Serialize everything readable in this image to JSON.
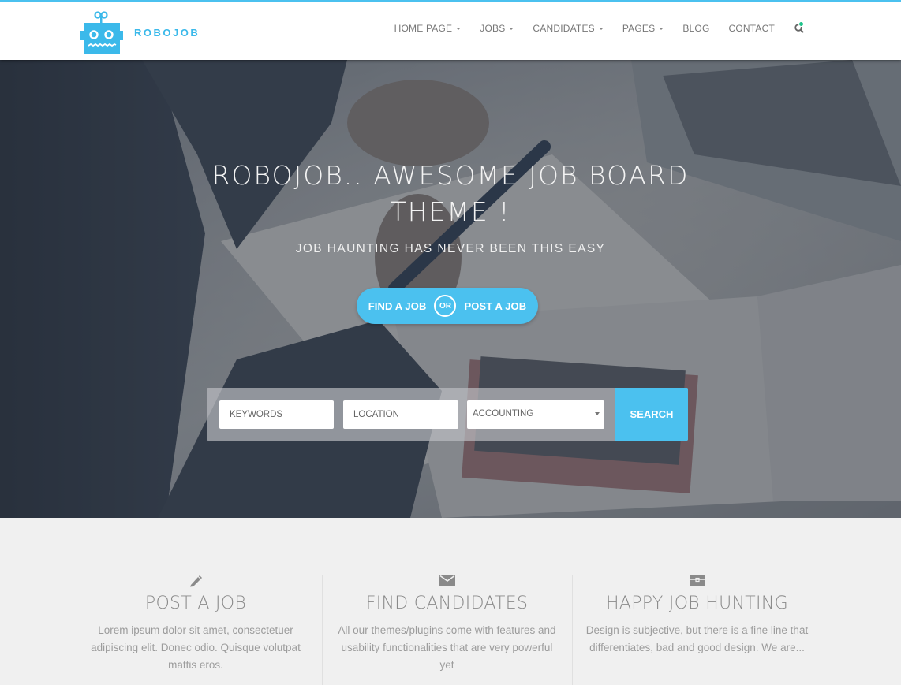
{
  "header": {
    "brand": "ROBOJOB",
    "nav": [
      {
        "label": "HOME PAGE",
        "dropdown": true
      },
      {
        "label": "JOBS",
        "dropdown": true
      },
      {
        "label": "CANDIDATES",
        "dropdown": true
      },
      {
        "label": "PAGES",
        "dropdown": true
      },
      {
        "label": "BLOG",
        "dropdown": false
      },
      {
        "label": "CONTACT",
        "dropdown": false
      }
    ],
    "search_icon": "search-icon",
    "avatar_status": "online"
  },
  "hero": {
    "title_line1": "ROBOJOB.. AWESOME JOB BOARD",
    "title_line2": "THEME !",
    "subtitle": "JOB HAUNTING HAS NEVER BEEN THIS EASY",
    "cta": {
      "find_label": "FIND A JOB",
      "or_label": "OR",
      "post_label": "POST A JOB"
    },
    "search": {
      "keywords_placeholder": "KEYWORDS",
      "location_placeholder": "LOCATION",
      "category_value": "ACCOUNTING",
      "button_label": "SEARCH"
    }
  },
  "features": [
    {
      "icon": "pencil-icon",
      "title": "POST A JOB",
      "text": "Lorem ipsum dolor sit amet, consectetuer adipiscing elit. Donec odio. Quisque volutpat mattis eros."
    },
    {
      "icon": "envelope-icon",
      "title": "FIND CANDIDATES",
      "text": "All our themes/plugins come with features and usability functionalities that are very powerful yet"
    },
    {
      "icon": "briefcase-icon",
      "title": "HAPPY JOB HUNTING",
      "text": "Design is subjective, but there is a fine line that differentiates, bad and good design. We are..."
    }
  ],
  "colors": {
    "accent": "#4bc1ef",
    "online": "#1fc38b",
    "text_muted": "#8a8a8a"
  }
}
